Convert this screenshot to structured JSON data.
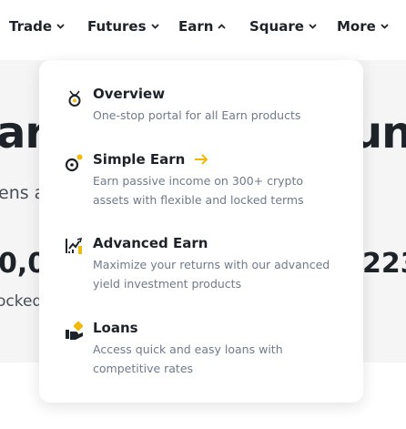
{
  "nav": {
    "items": [
      {
        "label": "Trade",
        "icon": "chevron-down-icon"
      },
      {
        "label": "Futures",
        "icon": "chevron-down-icon"
      },
      {
        "label": "Earn",
        "icon": "chevron-up-icon"
      },
      {
        "label": "Square",
        "icon": "chevron-down-icon"
      },
      {
        "label": "More",
        "icon": "chevron-down-icon"
      }
    ]
  },
  "background": {
    "heading_left": "ar",
    "heading_right": "un",
    "subtitle_left": "ens a",
    "value_left": "0,0",
    "value_right": "223",
    "locked_left": "ocked"
  },
  "earn_menu": {
    "items": [
      {
        "title": "Overview",
        "description": "One-stop portal for all Earn products",
        "icon": "overview-icon"
      },
      {
        "title": "Simple Earn",
        "description": "Earn passive income on 300+ crypto assets with flexible and locked terms",
        "icon": "simple-earn-icon",
        "highlighted": true
      },
      {
        "title": "Advanced Earn",
        "description": "Maximize your returns with our advanced yield investment products",
        "icon": "advanced-earn-icon"
      },
      {
        "title": "Loans",
        "description": "Access quick and easy loans with competitive rates",
        "icon": "loans-icon"
      }
    ]
  },
  "colors": {
    "accent": "#f0b90b",
    "text": "#1e2329",
    "muted": "#707a8a",
    "hero_bg": "#f5f5f5"
  }
}
